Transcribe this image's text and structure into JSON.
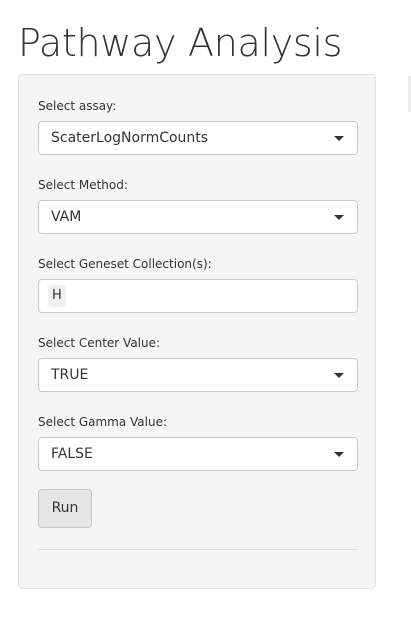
{
  "page": {
    "title": "Pathway Analysis"
  },
  "form": {
    "assay": {
      "label": "Select assay:",
      "value": "ScaterLogNormCounts"
    },
    "method": {
      "label": "Select Method:",
      "value": "VAM"
    },
    "geneset": {
      "label": "Select Geneset Collection(s):",
      "selected": [
        "H"
      ]
    },
    "center": {
      "label": "Select Center Value:",
      "value": "TRUE"
    },
    "gamma": {
      "label": "Select Gamma Value:",
      "value": "FALSE"
    },
    "run_label": "Run"
  },
  "icons": {
    "dropdown": "caret-down-icon"
  },
  "colors": {
    "panel_background": "#f5f5f5",
    "button_background": "#e6e6e6",
    "text": "#333333"
  }
}
